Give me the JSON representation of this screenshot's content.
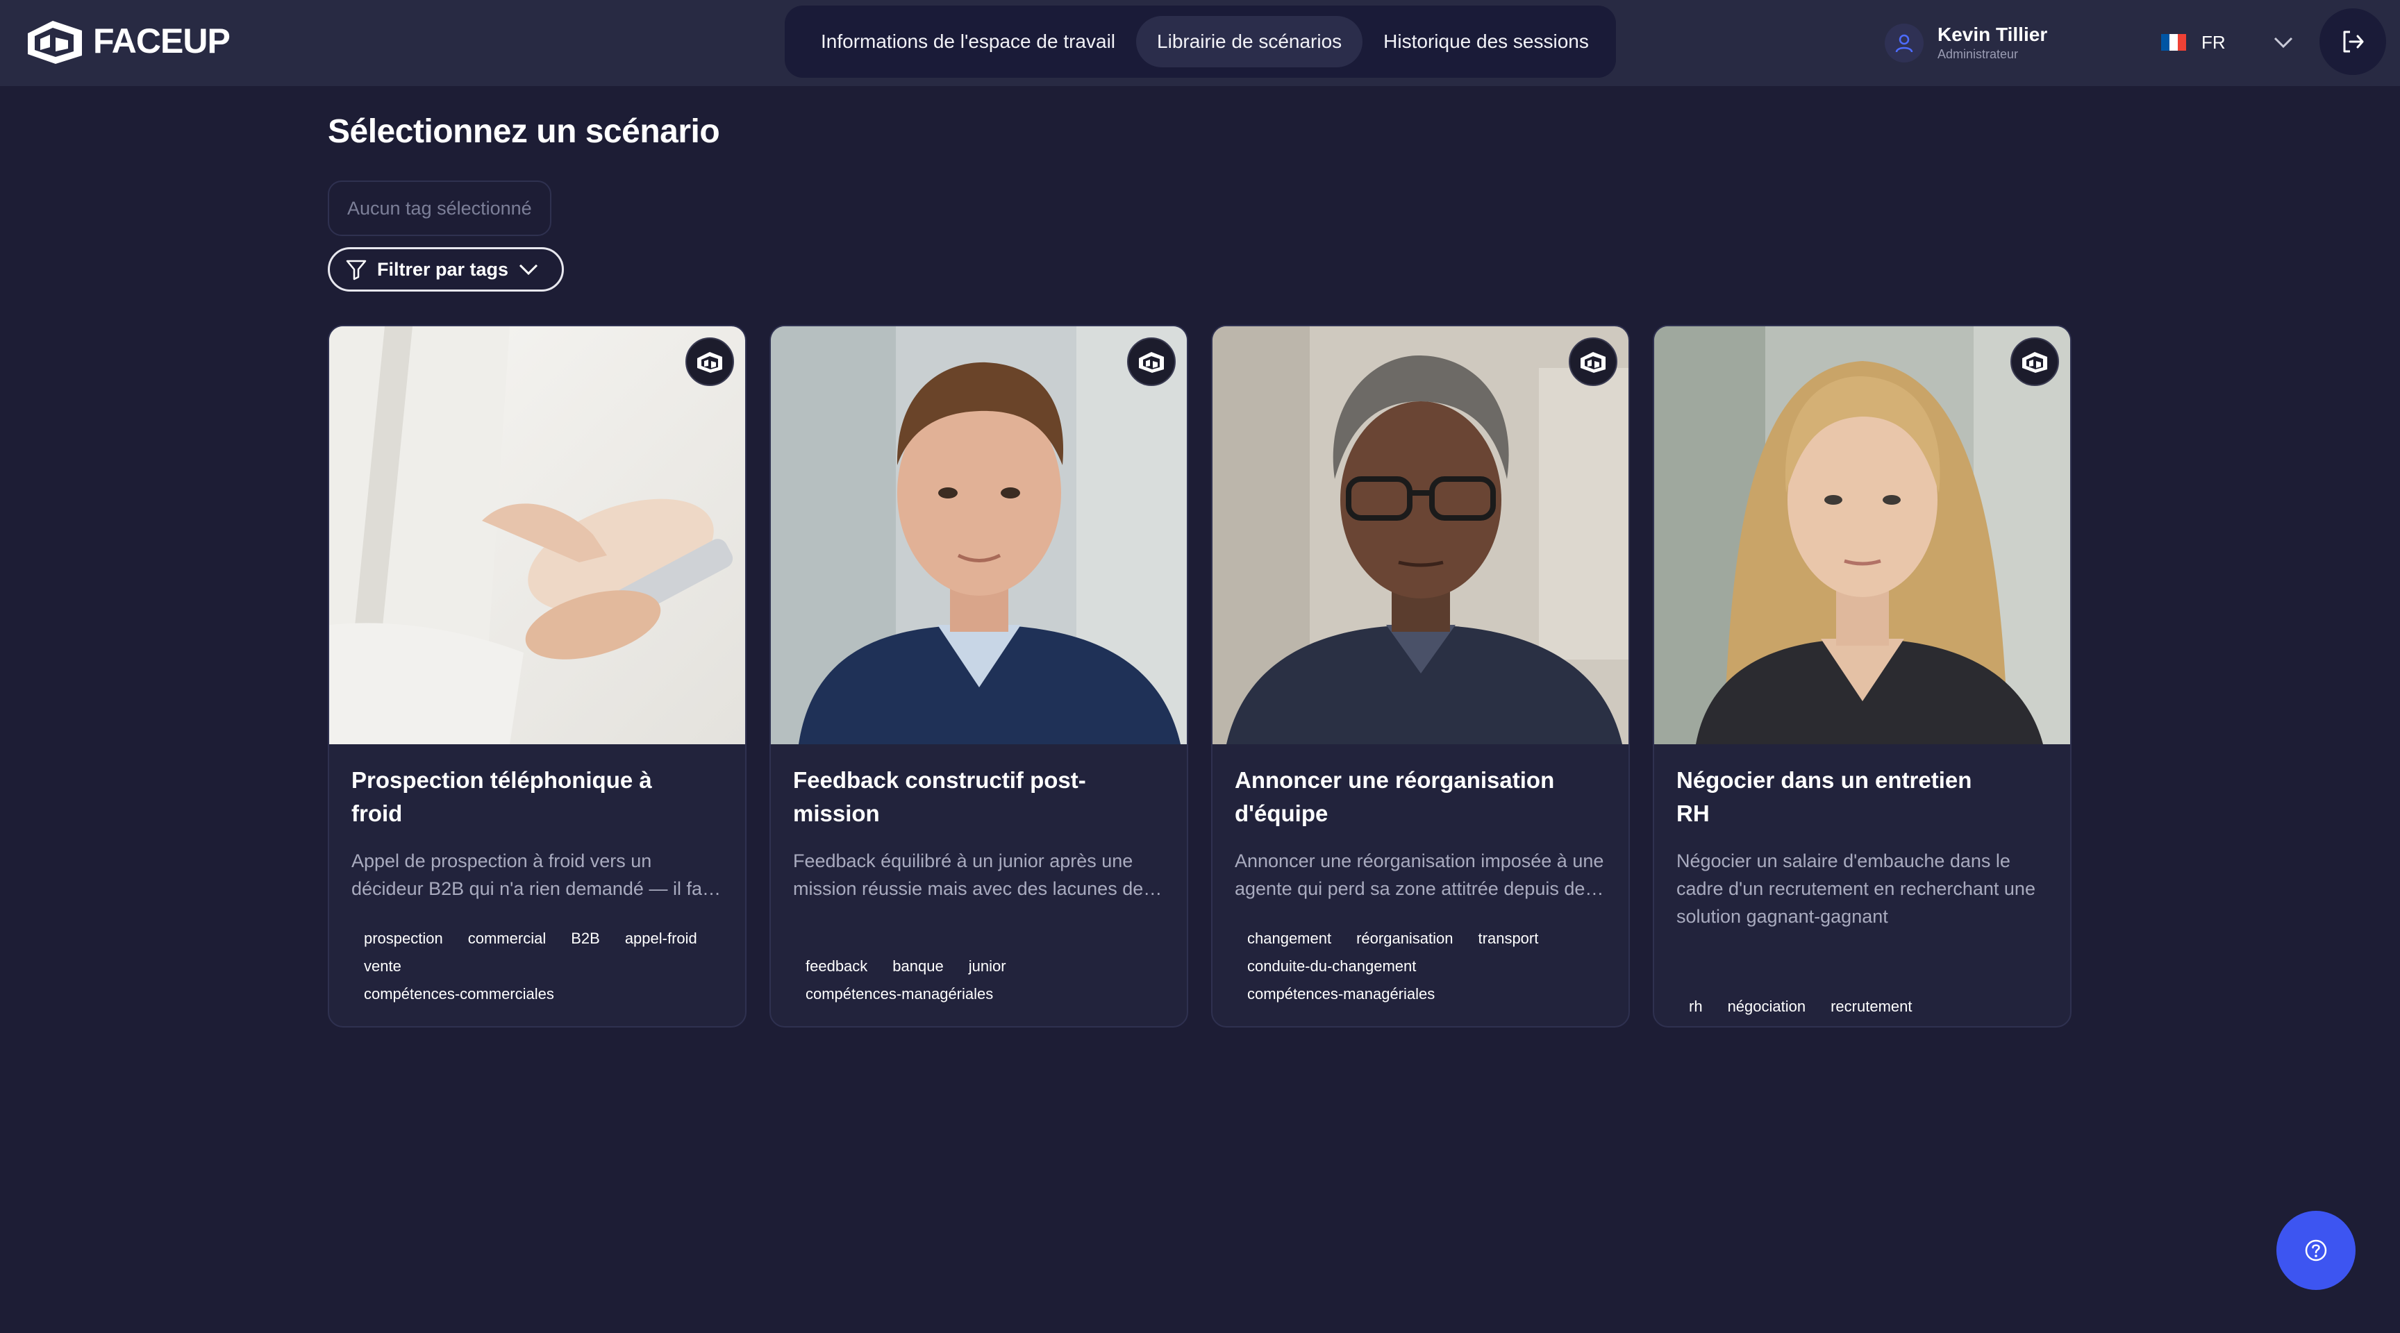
{
  "brand": {
    "name": "FACEUP"
  },
  "nav": {
    "items": [
      {
        "label": "Informations de l'espace de travail",
        "active": false
      },
      {
        "label": "Librairie de scénarios",
        "active": true
      },
      {
        "label": "Historique des sessions",
        "active": false
      }
    ]
  },
  "user": {
    "name": "Kevin Tillier",
    "role": "Administrateur",
    "icon": "user-icon"
  },
  "language": {
    "code": "FR",
    "flag_colors": [
      "#0055a4",
      "#ffffff",
      "#ef4135"
    ]
  },
  "page": {
    "title": "Sélectionnez un scénario",
    "tag_box_placeholder": "Aucun tag sélectionné",
    "filter_label": "Filtrer par tags"
  },
  "cards": [
    {
      "title": "Prospection téléphonique à froid",
      "description": "Appel de prospection à froid vers un décideur B2B qui n'a rien demandé — il faut capter son attention en quelques secondes",
      "tags": [
        "prospection",
        "commercial",
        "B2B",
        "appel-froid",
        "vente",
        "compétences-commerciales"
      ],
      "image": "hand-holding-smartphone"
    },
    {
      "title": "Feedback constructif post-mission",
      "description": "Feedback équilibré à un junior après une mission réussie mais avec des lacunes de suivi administratif",
      "tags": [
        "feedback",
        "banque",
        "junior",
        "compétences-managériales"
      ],
      "image": "young-man-in-blue-suit"
    },
    {
      "title": "Annoncer une réorganisation d'équipe",
      "description": "Annoncer une réorganisation imposée à une agente qui perd sa zone attitrée depuis des années",
      "tags": [
        "changement",
        "réorganisation",
        "transport",
        "conduite-du-changement",
        "compétences-managériales"
      ],
      "image": "woman-with-glasses"
    },
    {
      "title": "Négocier dans un entretien RH",
      "description": "Négocier un salaire d'embauche dans le cadre d'un recrutement en recherchant une solution gagnant-gagnant",
      "tags": [
        "rh",
        "négociation",
        "recrutement"
      ],
      "image": "blonde-woman-portrait"
    }
  ],
  "colors": {
    "background": "#1d1d35",
    "topbar": "#282a43",
    "card": "#22233c",
    "accent": "#3d55f1"
  }
}
